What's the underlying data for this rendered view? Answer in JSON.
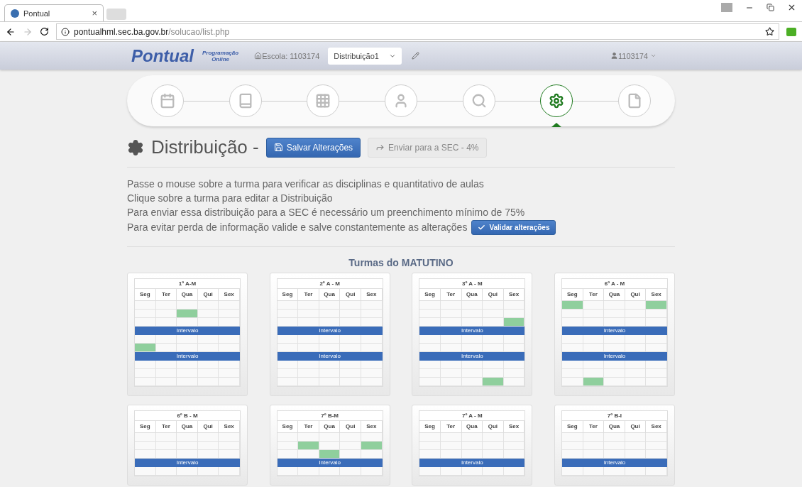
{
  "browser": {
    "tab_title": "Pontual",
    "tab_close": "×",
    "url_host": "pontualhml.sec.ba.gov.br",
    "url_path": "/solucao/list.php"
  },
  "navbar": {
    "brand": "Pontual",
    "subtitle_1": "Programação",
    "subtitle_2": "Online",
    "school": "Escola: 1103174",
    "distribution": "Distribuição1",
    "user": "1103174"
  },
  "steps": [
    {
      "kind": "calendar",
      "selected": false
    },
    {
      "kind": "book",
      "selected": false
    },
    {
      "kind": "grid",
      "selected": false
    },
    {
      "kind": "user",
      "selected": false
    },
    {
      "kind": "search",
      "selected": false
    },
    {
      "kind": "gear",
      "selected": true
    },
    {
      "kind": "file",
      "selected": false
    }
  ],
  "heading": {
    "title": "Distribuição -",
    "save_button": "Salvar Alterações",
    "send_button": "Enviar para a SEC - 4%"
  },
  "instructions": [
    "Passe o mouse sobre a turma para verificar as disciplinas e quantitativo de aulas",
    "Clique sobre a turma para editar a Distribuição",
    "Para enviar essa distribuição para a SEC é necessário um preenchimento mínimo de 75%",
    "Para evitar perda de informação valide e salve constantemente as alterações"
  ],
  "validate_button": "Validar alterações",
  "section_title": "Turmas do MATUTINO",
  "cards": [
    {
      "title": "1º A-M",
      "days": [
        "Seg",
        "Ter",
        "Qua",
        "Qui",
        "Sex"
      ],
      "rows": [
        {
          "kind": "slots",
          "cells": [
            false,
            false,
            false,
            false,
            false
          ]
        },
        {
          "kind": "slots",
          "cells": [
            false,
            false,
            true,
            false,
            false
          ]
        },
        {
          "kind": "slots",
          "cells": [
            false,
            false,
            false,
            false,
            false
          ]
        },
        {
          "kind": "break",
          "label": "Intervalo"
        },
        {
          "kind": "slots",
          "cells": [
            false,
            false,
            false,
            false,
            false
          ]
        },
        {
          "kind": "slots",
          "cells": [
            true,
            false,
            false,
            false,
            false
          ]
        },
        {
          "kind": "break",
          "label": "Intervalo"
        },
        {
          "kind": "slots",
          "cells": [
            false,
            false,
            false,
            false,
            false
          ]
        },
        {
          "kind": "slots",
          "cells": [
            false,
            false,
            false,
            false,
            false
          ]
        },
        {
          "kind": "slots",
          "cells": [
            false,
            false,
            false,
            false,
            false
          ]
        }
      ]
    },
    {
      "title": "2º A - M",
      "days": [
        "Seg",
        "Ter",
        "Qua",
        "Qui",
        "Sex"
      ],
      "rows": [
        {
          "kind": "slots",
          "cells": [
            false,
            false,
            false,
            false,
            false
          ]
        },
        {
          "kind": "slots",
          "cells": [
            false,
            false,
            false,
            false,
            false
          ]
        },
        {
          "kind": "slots",
          "cells": [
            false,
            false,
            false,
            false,
            false
          ]
        },
        {
          "kind": "break",
          "label": "Intervalo"
        },
        {
          "kind": "slots",
          "cells": [
            false,
            false,
            false,
            false,
            false
          ]
        },
        {
          "kind": "slots",
          "cells": [
            false,
            false,
            false,
            false,
            false
          ]
        },
        {
          "kind": "break",
          "label": "Intervalo"
        },
        {
          "kind": "slots",
          "cells": [
            false,
            false,
            false,
            false,
            false
          ]
        },
        {
          "kind": "slots",
          "cells": [
            false,
            false,
            false,
            false,
            false
          ]
        },
        {
          "kind": "slots",
          "cells": [
            false,
            false,
            false,
            false,
            false
          ]
        }
      ]
    },
    {
      "title": "3º A - M",
      "days": [
        "Seg",
        "Ter",
        "Qua",
        "Qui",
        "Sex"
      ],
      "rows": [
        {
          "kind": "slots",
          "cells": [
            false,
            false,
            false,
            false,
            false
          ]
        },
        {
          "kind": "slots",
          "cells": [
            false,
            false,
            false,
            false,
            false
          ]
        },
        {
          "kind": "slots",
          "cells": [
            false,
            false,
            false,
            false,
            true
          ]
        },
        {
          "kind": "break",
          "label": "Intervalo"
        },
        {
          "kind": "slots",
          "cells": [
            false,
            false,
            false,
            false,
            false
          ]
        },
        {
          "kind": "slots",
          "cells": [
            false,
            false,
            false,
            false,
            false
          ]
        },
        {
          "kind": "break",
          "label": "Intervalo"
        },
        {
          "kind": "slots",
          "cells": [
            false,
            false,
            false,
            false,
            false
          ]
        },
        {
          "kind": "slots",
          "cells": [
            false,
            false,
            false,
            false,
            false
          ]
        },
        {
          "kind": "slots",
          "cells": [
            false,
            false,
            false,
            true,
            false
          ]
        }
      ]
    },
    {
      "title": "6º A - M",
      "days": [
        "Seg",
        "Ter",
        "Qua",
        "Qui",
        "Sex"
      ],
      "rows": [
        {
          "kind": "slots",
          "cells": [
            true,
            false,
            false,
            false,
            true
          ]
        },
        {
          "kind": "slots",
          "cells": [
            false,
            false,
            false,
            false,
            false
          ]
        },
        {
          "kind": "slots",
          "cells": [
            false,
            false,
            false,
            false,
            false
          ]
        },
        {
          "kind": "break",
          "label": "Intervalo"
        },
        {
          "kind": "slots",
          "cells": [
            false,
            false,
            false,
            false,
            false
          ]
        },
        {
          "kind": "slots",
          "cells": [
            false,
            false,
            false,
            false,
            false
          ]
        },
        {
          "kind": "break",
          "label": "Intervalo"
        },
        {
          "kind": "slots",
          "cells": [
            false,
            false,
            false,
            false,
            false
          ]
        },
        {
          "kind": "slots",
          "cells": [
            false,
            false,
            false,
            false,
            false
          ]
        },
        {
          "kind": "slots",
          "cells": [
            false,
            true,
            false,
            false,
            false
          ]
        }
      ]
    },
    {
      "title": "6º B - M",
      "days": [
        "Seg",
        "Ter",
        "Qua",
        "Qui",
        "Sex"
      ],
      "rows": [
        {
          "kind": "slots",
          "cells": [
            false,
            false,
            false,
            false,
            false
          ]
        },
        {
          "kind": "slots",
          "cells": [
            false,
            false,
            false,
            false,
            false
          ]
        },
        {
          "kind": "slots",
          "cells": [
            false,
            false,
            false,
            false,
            false
          ]
        },
        {
          "kind": "break",
          "label": "Intervalo"
        },
        {
          "kind": "slots",
          "cells": [
            false,
            false,
            false,
            false,
            false
          ]
        }
      ]
    },
    {
      "title": "7º B-M",
      "days": [
        "Seg",
        "Ter",
        "Qua",
        "Qui",
        "Sex"
      ],
      "rows": [
        {
          "kind": "slots",
          "cells": [
            false,
            false,
            false,
            false,
            false
          ]
        },
        {
          "kind": "slots",
          "cells": [
            false,
            true,
            false,
            false,
            true
          ]
        },
        {
          "kind": "slots",
          "cells": [
            false,
            false,
            true,
            false,
            false
          ]
        },
        {
          "kind": "break",
          "label": "Intervalo"
        },
        {
          "kind": "slots",
          "cells": [
            false,
            false,
            false,
            false,
            false
          ]
        }
      ]
    },
    {
      "title": "7º A - M",
      "days": [
        "Seg",
        "Ter",
        "Qua",
        "Qui",
        "Sex"
      ],
      "rows": [
        {
          "kind": "slots",
          "cells": [
            false,
            false,
            false,
            false,
            false
          ]
        },
        {
          "kind": "slots",
          "cells": [
            false,
            false,
            false,
            false,
            false
          ]
        },
        {
          "kind": "slots",
          "cells": [
            false,
            false,
            false,
            false,
            false
          ]
        },
        {
          "kind": "break",
          "label": "Intervalo"
        },
        {
          "kind": "slots",
          "cells": [
            false,
            false,
            false,
            false,
            false
          ]
        }
      ]
    },
    {
      "title": "7º B-I",
      "days": [
        "Seg",
        "Ter",
        "Qua",
        "Qui",
        "Sex"
      ],
      "rows": [
        {
          "kind": "slots",
          "cells": [
            false,
            false,
            false,
            false,
            false
          ]
        },
        {
          "kind": "slots",
          "cells": [
            false,
            false,
            false,
            false,
            false
          ]
        },
        {
          "kind": "slots",
          "cells": [
            false,
            false,
            false,
            false,
            false
          ]
        },
        {
          "kind": "break",
          "label": "Intervalo"
        },
        {
          "kind": "slots",
          "cells": [
            false,
            false,
            false,
            false,
            false
          ]
        }
      ]
    }
  ]
}
